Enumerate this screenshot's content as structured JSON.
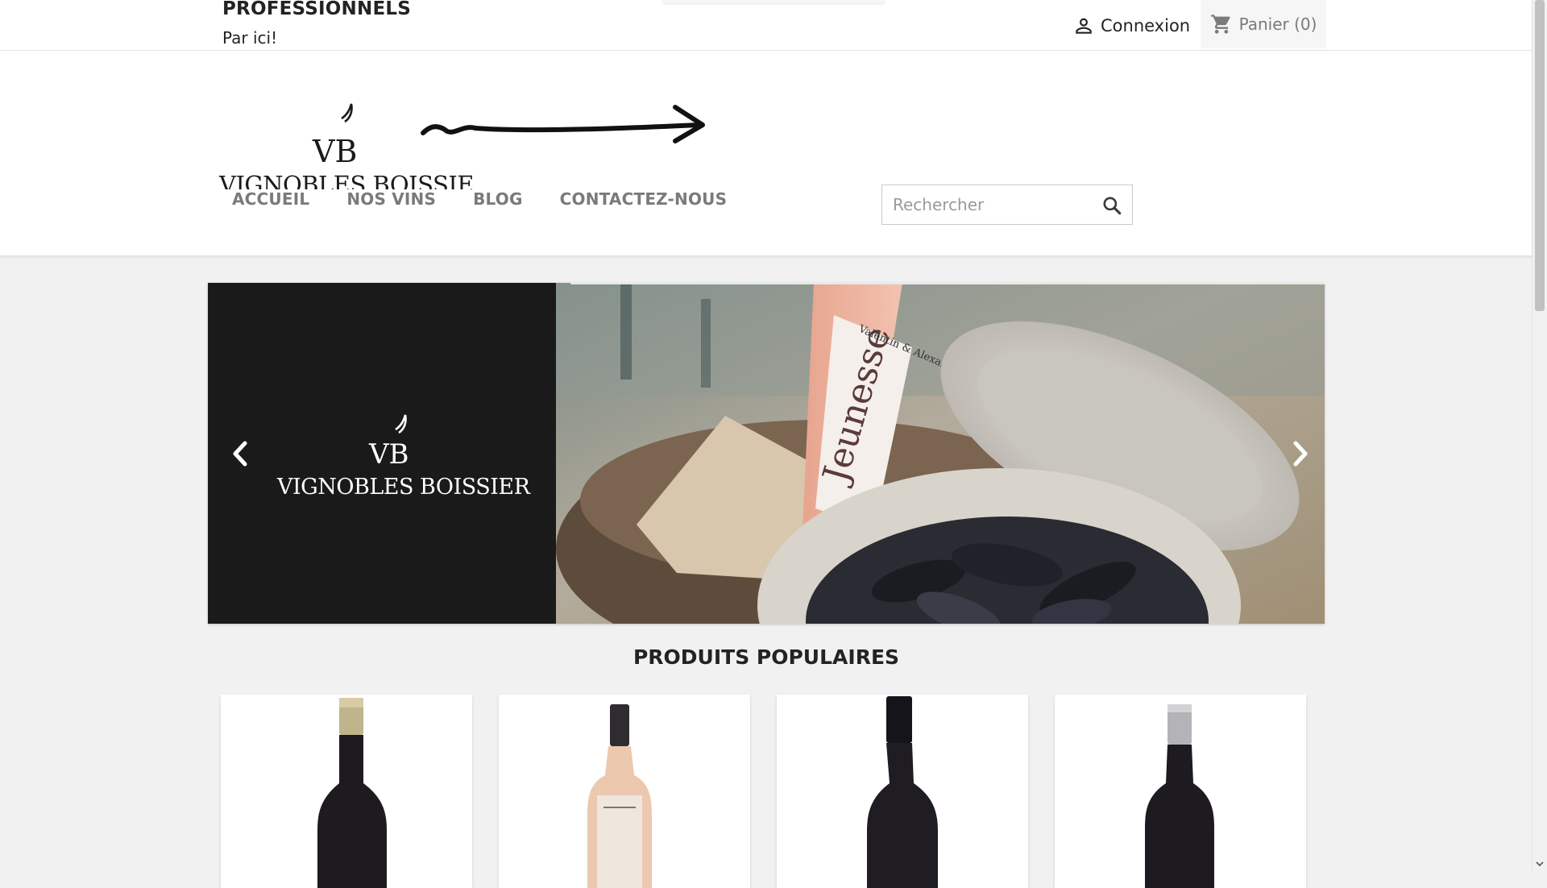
{
  "header": {
    "pro_title": "PROFESSIONNELS",
    "pro_link": "Par ici!",
    "login_label": "Connexion",
    "cart_label": "Panier (0)"
  },
  "brand": {
    "name": "VIGNOBLES BOISSIER",
    "monogram": "VB"
  },
  "nav": [
    {
      "label": "ACCUEIL"
    },
    {
      "label": "NOS VINS"
    },
    {
      "label": "BLOG"
    },
    {
      "label": "CONTACTEZ-NOUS"
    }
  ],
  "search": {
    "placeholder": "Rechercher"
  },
  "carousel": {
    "brand_name": "VIGNOBLES BOISSIER",
    "monogram": "VB",
    "bottle_label_script": "Jeunesse",
    "bottle_label_top": "Valentin & Alexandre B."
  },
  "section": {
    "popular_title": "PRODUITS POPULAIRES"
  },
  "products": [
    {
      "name": "red-wine-bottle-gold-cap"
    },
    {
      "name": "rose-wine-bottle"
    },
    {
      "name": "red-wine-bottle-black"
    },
    {
      "name": "red-wine-bottle-silver-cap"
    }
  ],
  "colors": {
    "text": "#232323",
    "nav": "#7a7a7a",
    "background": "#f1f1f1",
    "slide_dark": "#1b1a1a"
  }
}
